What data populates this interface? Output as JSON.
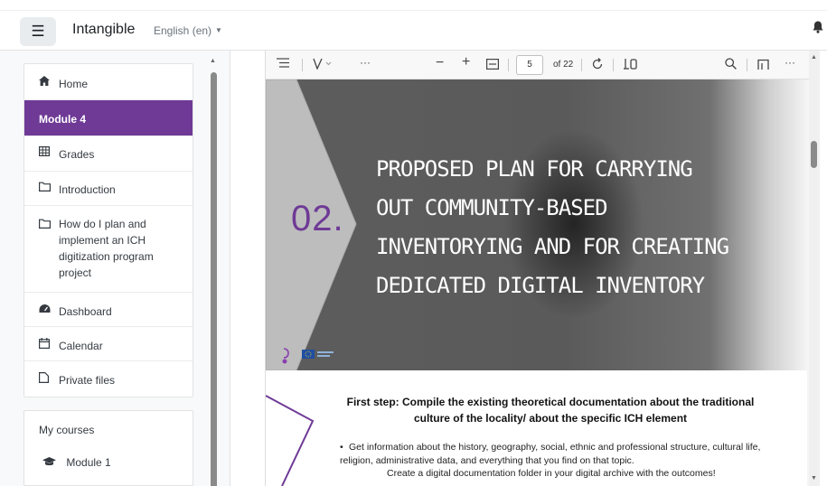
{
  "navbar": {
    "drawer_icon": "hamburger-icon",
    "site_name": "Intangible",
    "language": "English (en)",
    "language_caret": "▼",
    "notification_icon": "bell-icon"
  },
  "course_index": {
    "items": [
      {
        "icon": "home-icon",
        "label": "Home"
      },
      {
        "label": "Module 4"
      },
      {
        "icon": "table-icon",
        "label": "Grades"
      },
      {
        "icon": "folder-icon",
        "label": "Introduction"
      },
      {
        "icon": "folder-icon",
        "label": "How do I plan and implement an ICH digitization program project"
      },
      {
        "icon": "dashboard-icon",
        "label": "Dashboard"
      },
      {
        "icon": "calendar-icon",
        "label": "Calendar"
      },
      {
        "icon": "file-icon",
        "label": "Private files"
      }
    ]
  },
  "my_courses": {
    "title": "My courses",
    "items": [
      {
        "icon": "graduation-cap-icon",
        "label": "Module 1"
      }
    ]
  },
  "pdf_toolbar": {
    "sidebar_icon": "outline-icon",
    "draw_icon": "draw-icon",
    "more_left_icon": "more-icon",
    "zoom_out": "−",
    "zoom_in": "+",
    "fit_icon": "fit-page-icon",
    "page_current": "5",
    "page_total": "of 22",
    "rotate_icon": "rotate-icon",
    "page_view_icon": "page-view-icon",
    "search_icon": "search-icon",
    "read_aloud_icon": "read-aloud-icon",
    "more_right_icon": "more-icon"
  },
  "slide": {
    "number": "02.",
    "title_lines": [
      "Proposed plan for carrying",
      "out community-based",
      "inventorying and for creating",
      "dedicated digital inventory"
    ],
    "colors": {
      "purple": "#6f3a96",
      "dark_gray": "#5a5a5a",
      "light_gray": "#b9b9b9"
    }
  },
  "document": {
    "step_title": "First step: Compile the existing theoretical documentation about the traditional culture of the locality/ about the specific ICH element",
    "bullet": "Get information about the history, geography, social, ethnic and professional structure, cultural life, religion, administrative data, and everything that you find on that topic.",
    "note": "Create a digital documentation folder in your digital archive with the outcomes!"
  }
}
